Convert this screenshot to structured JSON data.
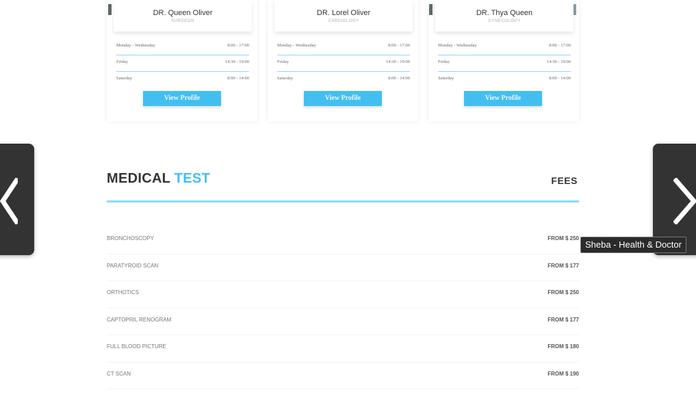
{
  "doctors": [
    {
      "name": "DR. Queen Oliver",
      "specialty": "SURGEON",
      "schedule": [
        {
          "day": "Monday - Wednesday",
          "time": "8:00 - 17:00"
        },
        {
          "day": "Friday",
          "time": "14:30 - 19:00"
        },
        {
          "day": "Saturday",
          "time": "8:00 - 14:00"
        }
      ],
      "button_label": "View Profile"
    },
    {
      "name": "DR. Lorel Oliver",
      "specialty": "CARDIOLOGY",
      "schedule": [
        {
          "day": "Monday - Wednesday",
          "time": "8:00 - 17:00"
        },
        {
          "day": "Friday",
          "time": "14:30 - 19:00"
        },
        {
          "day": "Saturday",
          "time": "8:00 - 14:00"
        }
      ],
      "button_label": "View Profile"
    },
    {
      "name": "DR. Thya Queen",
      "specialty": "GYNECOLOGY",
      "schedule": [
        {
          "day": "Monday - Wednesday",
          "time": "8:00 - 17:00"
        },
        {
          "day": "Friday",
          "time": "14:30 - 19:00"
        },
        {
          "day": "Saturday",
          "time": "8:00 - 14:00"
        }
      ],
      "button_label": "View Profile"
    }
  ],
  "medical_test": {
    "title_main": "MEDICAL",
    "title_accent": "TEST",
    "fees_label": "FEES",
    "accent_color": "#3fc0ef",
    "tests": [
      {
        "name": "BRONCHOSCOPY",
        "price": "FROM $ 250"
      },
      {
        "name": "PARATYROID SCAN",
        "price": "FROM $ 177"
      },
      {
        "name": "ORTHOTICS",
        "price": "FROM $ 250"
      },
      {
        "name": "CAPTOPRIL RENOGRAM",
        "price": "FROM $ 177"
      },
      {
        "name": "FULL BLOOD PICTURE",
        "price": "FROM $ 180"
      },
      {
        "name": "CT SCAN",
        "price": "FROM $ 190"
      }
    ]
  },
  "nav": {
    "prev_icon": "chevron-left-icon",
    "next_icon": "chevron-right-icon"
  },
  "tooltip": {
    "text": "Sheba - Health & Doctor"
  }
}
